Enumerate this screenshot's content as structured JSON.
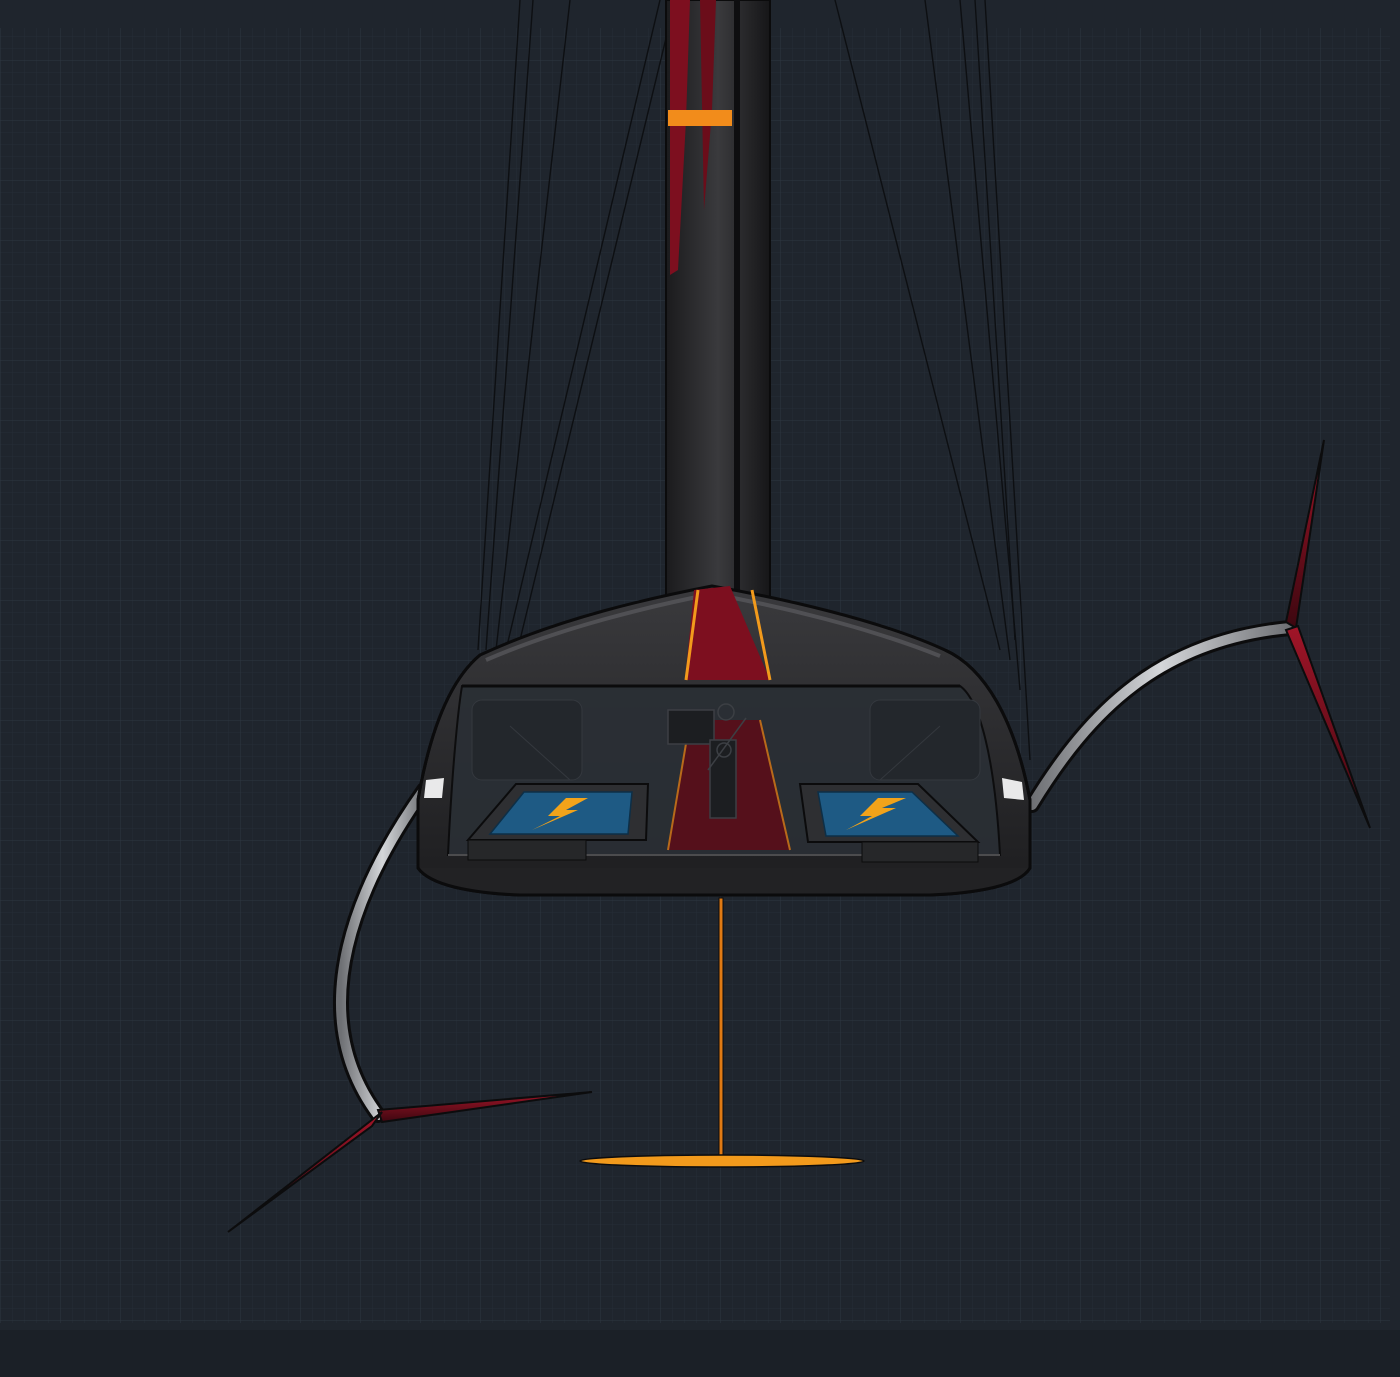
{
  "scene": {
    "subject": "foiling-monohull-yacht-front-view",
    "background": {
      "color": "#1f252d",
      "grid": true,
      "grid_color": "#2e3641",
      "grid_minor_color": "#262d36"
    },
    "colors": {
      "hull": "#2b2b2d",
      "hull_highlight": "#5b5b60",
      "mast": "#262628",
      "mast_band": "#f28c1b",
      "livery_red": "#7d0f1f",
      "pinstripe": "#f29a1c",
      "foil_arm": "#b8babd",
      "foil_wing": "#7a1020",
      "rudder": "#e07a14",
      "screen": "#1e5a84",
      "lightning": "#f2a31a"
    },
    "icons": [
      "lightning-bolt-icon",
      "lightning-bolt-icon"
    ]
  }
}
